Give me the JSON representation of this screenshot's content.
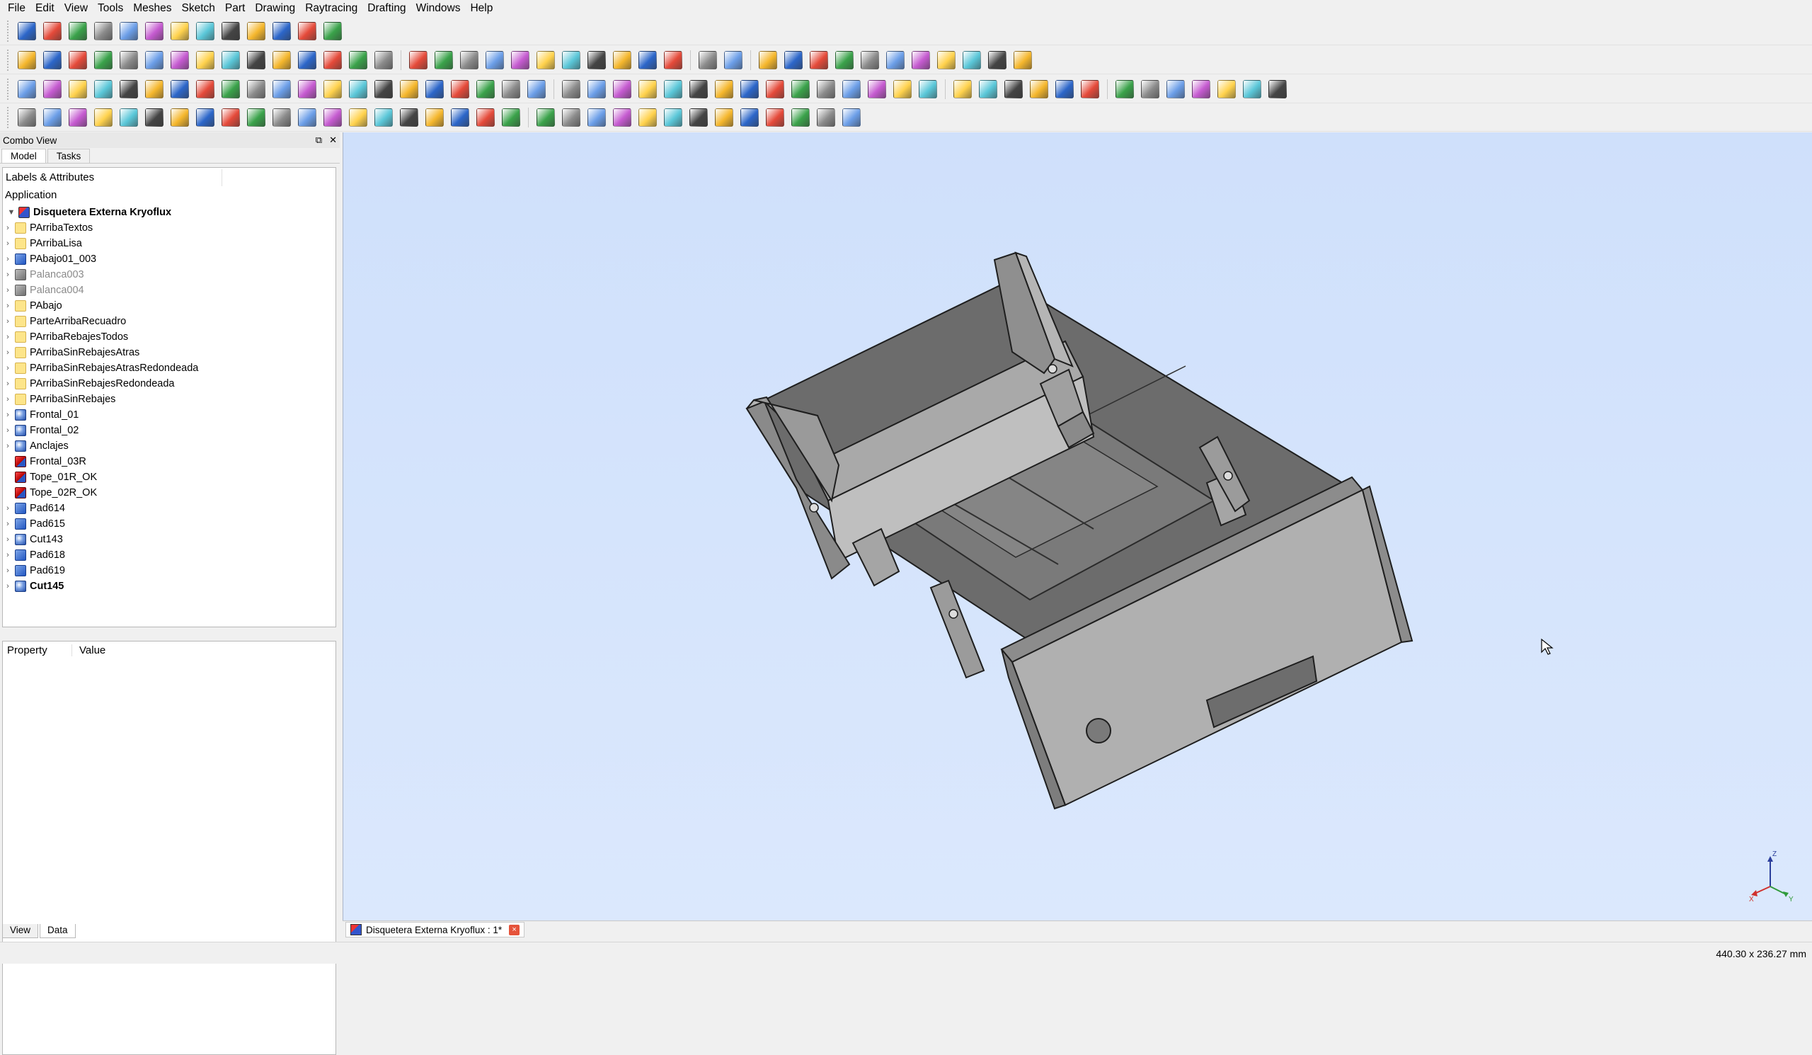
{
  "menu": [
    "File",
    "Edit",
    "View",
    "Tools",
    "Meshes",
    "Sketch",
    "Part",
    "Drawing",
    "Raytracing",
    "Drafting",
    "Windows",
    "Help"
  ],
  "combo_view": {
    "title": "Combo View",
    "tabs": [
      "Model",
      "Tasks"
    ],
    "tree_header": "Labels & Attributes",
    "application_label": "Application",
    "document_root": "Disquetera Externa Kryoflux",
    "tree_items": [
      {
        "label": "PArribaTextos",
        "icon": "folder-icon",
        "expandable": true,
        "greyed": false,
        "bold": false
      },
      {
        "label": "PArribaLisa",
        "icon": "folder-icon",
        "expandable": true,
        "greyed": false,
        "bold": false
      },
      {
        "label": "PAbajo01_003",
        "icon": "body-icon",
        "expandable": true,
        "greyed": false,
        "bold": false
      },
      {
        "label": "Palanca003",
        "icon": "body-grey-icon",
        "expandable": true,
        "greyed": true,
        "bold": false
      },
      {
        "label": "Palanca004",
        "icon": "body-grey-icon",
        "expandable": true,
        "greyed": true,
        "bold": false
      },
      {
        "label": "PAbajo",
        "icon": "folder-icon",
        "expandable": true,
        "greyed": false,
        "bold": false
      },
      {
        "label": "ParteArribaRecuadro",
        "icon": "folder-icon",
        "expandable": true,
        "greyed": false,
        "bold": false
      },
      {
        "label": "PArribaRebajesTodos",
        "icon": "folder-icon",
        "expandable": true,
        "greyed": false,
        "bold": false
      },
      {
        "label": "PArribaSinRebajesAtras",
        "icon": "folder-icon",
        "expandable": true,
        "greyed": false,
        "bold": false
      },
      {
        "label": "PArribaSinRebajesAtrasRedondeada",
        "icon": "folder-icon",
        "expandable": true,
        "greyed": false,
        "bold": false
      },
      {
        "label": "PArribaSinRebajesRedondeada",
        "icon": "folder-icon",
        "expandable": true,
        "greyed": false,
        "bold": false
      },
      {
        "label": "PArribaSinRebajes",
        "icon": "folder-icon",
        "expandable": true,
        "greyed": false,
        "bold": false
      },
      {
        "label": "Frontal_01",
        "icon": "sphere-icon",
        "expandable": true,
        "greyed": false,
        "bold": false
      },
      {
        "label": "Frontal_02",
        "icon": "sphere-icon",
        "expandable": true,
        "greyed": false,
        "bold": false
      },
      {
        "label": "Anclajes",
        "icon": "sphere-icon",
        "expandable": true,
        "greyed": false,
        "bold": false
      },
      {
        "label": "Frontal_03R",
        "icon": "cube-red-icon",
        "expandable": false,
        "greyed": false,
        "bold": false
      },
      {
        "label": "Tope_01R_OK",
        "icon": "cube-red-icon",
        "expandable": false,
        "greyed": false,
        "bold": false
      },
      {
        "label": "Tope_02R_OK",
        "icon": "cube-red-icon",
        "expandable": false,
        "greyed": false,
        "bold": false
      },
      {
        "label": "Pad614",
        "icon": "body-icon",
        "expandable": true,
        "greyed": false,
        "bold": false
      },
      {
        "label": "Pad615",
        "icon": "body-icon",
        "expandable": true,
        "greyed": false,
        "bold": false
      },
      {
        "label": "Cut143",
        "icon": "sphere-icon",
        "expandable": true,
        "greyed": false,
        "bold": false
      },
      {
        "label": "Pad618",
        "icon": "body-icon",
        "expandable": true,
        "greyed": false,
        "bold": false
      },
      {
        "label": "Pad619",
        "icon": "body-icon",
        "expandable": true,
        "greyed": false,
        "bold": false
      },
      {
        "label": "Cut145",
        "icon": "sphere-icon",
        "expandable": true,
        "greyed": false,
        "bold": true
      }
    ],
    "property_header": {
      "property": "Property",
      "value": "Value"
    },
    "bottom_tabs": [
      "View",
      "Data"
    ]
  },
  "toolbars": {
    "row1": [
      "new-document-icon",
      "new-drawing-a3-icon",
      "open-icon",
      "save-icon",
      "fit-all-icon",
      "isometric-view-icon",
      "front-view-icon",
      "top-view-icon",
      "right-view-icon",
      "rear-view-icon",
      "bottom-view-icon",
      "left-view-icon",
      "measure-icon"
    ],
    "row2_part": [
      "box-icon",
      "cylinder-icon",
      "sphere-icon",
      "cone-icon",
      "torus-icon",
      "union-icon",
      "cut-icon",
      "common-icon",
      "section-icon",
      "shape-builder-icon",
      "extrude-icon",
      "revolve-icon",
      "mirror-icon",
      "fillet-icon",
      "chamfer-icon"
    ],
    "row2_design": [
      "pad-icon",
      "pocket-icon",
      "revolution-icon",
      "groove-icon",
      "fillet-pd-icon",
      "chamfer-pd-icon",
      "draft-icon",
      "mirrored-icon",
      "linear-pattern-icon",
      "polar-pattern-icon",
      "multitransform-icon"
    ],
    "row2_drawing": [
      "drawing-page-icon",
      "drawing-export-icon"
    ],
    "row2_primitives": [
      "box-prim-icon",
      "boolean-icon",
      "cone-prim-icon",
      "cylinder-prim-icon",
      "tube-icon",
      "sphere-prim-icon",
      "torus-prim-icon",
      "loft-icon",
      "sweep-icon",
      "thickness-icon",
      "plane-icon"
    ],
    "row3_draft": [
      "line-icon",
      "wire-icon",
      "circle-icon",
      "arc-icon",
      "rectangle-icon",
      "polygon-icon",
      "bspline-icon",
      "text-icon",
      "dimension-icon",
      "move-icon",
      "rotate-icon",
      "offset-icon",
      "trim-icon",
      "upgrade-icon",
      "downgrade-icon",
      "scale-icon",
      "edit-icon",
      "wire-to-spline-icon",
      "add-point-icon",
      "del-point-icon",
      "shape2dview-icon"
    ],
    "row3_constraints": [
      "point-constraint-icon",
      "tangent-constraint-icon",
      "vertical-constraint-icon",
      "horizontal-constraint-icon",
      "parallel-constraint-icon",
      "perpendicular-constraint-icon",
      "tangent2-constraint-icon",
      "equal-constraint-icon",
      "symmetric-constraint-icon",
      "lock-constraint-icon",
      "horizontal-distance-icon",
      "vertical-distance-icon",
      "distance-icon",
      "radius-icon",
      "angle-icon"
    ],
    "row3_render": [
      "raytrace-project-icon",
      "raytrace-part-icon",
      "raytrace-export-icon",
      "raytrace-camera-icon",
      "raytrace-render-icon",
      "raytrace-forward-icon"
    ],
    "row3_mesh": [
      "mesh-import-icon",
      "mesh-from-shape-icon",
      "mesh-harmonize-icon",
      "mesh-flip-icon",
      "mesh-fill-icon",
      "mesh-evaluate-icon",
      "mesh-segment-icon"
    ],
    "row4_sketch": [
      "sketch-arc-icon",
      "sketch-line-icon",
      "sketch-circle-icon",
      "sketch-conic-icon",
      "sketch-polygon-icon",
      "sketch-slot-icon",
      "sketch-fillet-icon",
      "sketch-trim-icon",
      "sketch-extend-icon",
      "sketch-external-icon",
      "sketch-construction-icon",
      "sketch-point-icon",
      "sketch-bspline-icon",
      "sketch-rect-icon",
      "sketch-ellipse-icon",
      "sketch-hexagon-icon",
      "sketch-copy-icon",
      "sketch-array-icon",
      "sketch-clone-icon",
      "sketch-validate-icon"
    ],
    "row4_tools": [
      "select-constraints-icon",
      "select-origin-icon",
      "select-elements-icon",
      "create-body-icon",
      "create-sketch-icon",
      "map-sketch-icon",
      "reorient-sketch-icon",
      "part-design-icon",
      "datum-plane-icon",
      "datum-line-icon",
      "datum-point-icon",
      "shape-binder-icon",
      "sub-shape-icon"
    ]
  },
  "document_tab": {
    "title": "Disquetera Externa Kryoflux : 1*",
    "close_glyph": "×"
  },
  "status": {
    "dimensions": "440.30 x 236.27 mm"
  },
  "axis_widget": {
    "z_label": "Z",
    "y_label": "Y",
    "x_label": "X"
  },
  "colors": {
    "viewport_top": "#cfe0fb",
    "model_grey": "#9c9c9c",
    "axis_x": "#d0312d",
    "axis_y": "#2f9a3a",
    "axis_z": "#2b3e9c"
  }
}
